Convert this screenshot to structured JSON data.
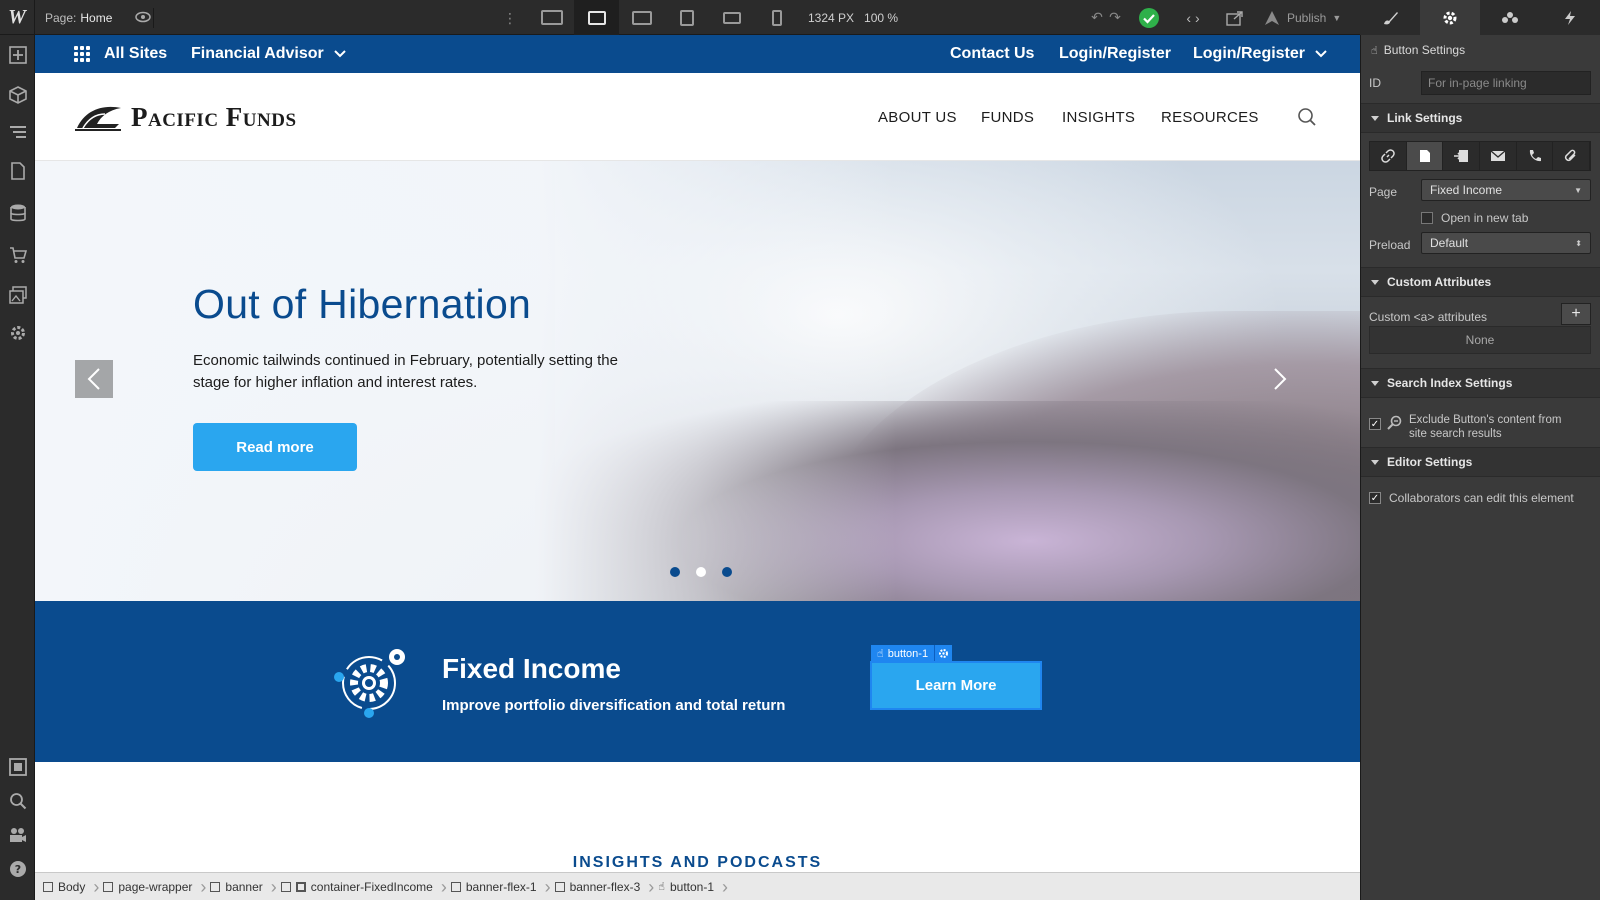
{
  "toolbar": {
    "logo": "W",
    "page_label": "Page:",
    "page_name": "Home",
    "size_px": "1324 PX",
    "zoom": "100 %",
    "publish_label": "Publish"
  },
  "site": {
    "topnav": {
      "all_sites": "All Sites",
      "site_name": "Financial Advisor",
      "contact": "Contact Us",
      "login1": "Login/Register",
      "login2": "Login/Register"
    },
    "brand": "Pacific Funds",
    "mainnav": [
      "ABOUT US",
      "FUNDS",
      "INSIGHTS",
      "RESOURCES"
    ],
    "hero": {
      "title": "Out of Hibernation",
      "text": "Economic tailwinds continued in February, potentially setting the stage for higher inflation and interest rates.",
      "button": "Read more",
      "active_slide": 1,
      "slides": 3
    },
    "banner": {
      "title": "Fixed Income",
      "subtitle": "Improve portfolio diversification and total return",
      "button": "Learn More",
      "selected_tag": "button-1"
    },
    "insights_title": "INSIGHTS AND PODCASTS"
  },
  "breadcrumbs": [
    "Body",
    "page-wrapper",
    "banner",
    "container-FixedIncome",
    "banner-flex-1",
    "banner-flex-3",
    "button-1"
  ],
  "panel": {
    "header": "Button Settings",
    "id_label": "ID",
    "id_placeholder": "For in-page linking",
    "link_settings": "Link Settings",
    "page_label": "Page",
    "page_value": "Fixed Income",
    "open_new_tab": "Open in new tab",
    "preload_label": "Preload",
    "preload_value": "Default",
    "custom_attributes": "Custom Attributes",
    "custom_a_attrs": "Custom <a> attributes",
    "none": "None",
    "search_index": "Search Index Settings",
    "exclude_text": "Exclude Button's content from site search results",
    "editor_settings": "Editor Settings",
    "collaborators": "Collaborators can edit this element"
  },
  "colors": {
    "brand_blue": "#0a4b8e",
    "button_blue": "#2aa6ef",
    "selection_blue": "#1f86f0",
    "chrome_dark": "#2b2b2b",
    "panel_bg": "#3a3a3a"
  }
}
